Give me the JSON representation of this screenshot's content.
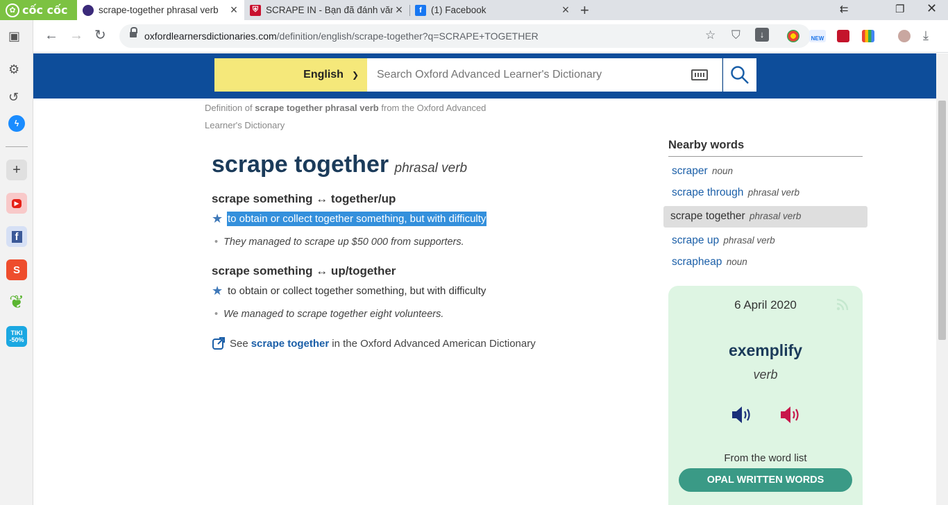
{
  "browser": {
    "brand": "cốc cốc",
    "tabs": [
      {
        "title": "scrape-together phrasal verb",
        "favicon": "oxford-globe-icon",
        "active": true
      },
      {
        "title": "SCRAPE IN - Bạn đã đánh văn",
        "favicon": "cambridge-shield-icon",
        "active": false
      },
      {
        "title": "(1) Facebook",
        "favicon": "facebook-icon",
        "active": false
      }
    ],
    "url_domain": "oxfordlearnersdictionaries.com",
    "url_path": "/definition/english/scrape-together?q=SCRAPE+TOGETHER",
    "sidebar_badges": {
      "shopee": "S",
      "tiki": "TIKI",
      "tiki_discount": "-50%"
    }
  },
  "header": {
    "language": "English",
    "search_placeholder": "Search Oxford Advanced Learner's Dictionary"
  },
  "breadcrumb": {
    "prefix": "Definition of",
    "term": "scrape together phrasal verb",
    "suffix": "from the Oxford Advanced Learner's Dictionary"
  },
  "entry": {
    "headword": "scrape together",
    "pos": "phrasal verb",
    "senses": [
      {
        "pattern": "scrape something ↔ together/up",
        "definition": "to obtain or collect together something, but with difficulty",
        "example": "They managed to scrape up $50 000 from supporters.",
        "highlighted": true
      },
      {
        "pattern": "scrape something ↔ up/together",
        "definition": "to obtain or collect together something, but with difficulty",
        "example": "We managed to scrape together eight volunteers.",
        "highlighted": false
      }
    ],
    "see_also": {
      "prefix": "See",
      "link": "scrape together",
      "suffix": "in the Oxford Advanced American Dictionary"
    }
  },
  "nearby": {
    "title": "Nearby words",
    "items": [
      {
        "word": "scraper",
        "pos": "noun",
        "current": false
      },
      {
        "word": "scrape through",
        "pos": "phrasal verb",
        "current": false
      },
      {
        "word": "scrape together",
        "pos": "phrasal verb",
        "current": true
      },
      {
        "word": "scrape up",
        "pos": "phrasal verb",
        "current": false
      },
      {
        "word": "scrapheap",
        "pos": "noun",
        "current": false
      }
    ]
  },
  "word_of_day": {
    "date": "6 April 2020",
    "word": "exemplify",
    "pos": "verb",
    "from_list_label": "From the word list",
    "list_name": "OPAL WRITTEN WORDS"
  },
  "colors": {
    "header_blue": "#0d4d9a",
    "lang_yellow": "#f5e87a",
    "highlight": "#3490dc",
    "link_blue": "#1b5fa8",
    "wotd_bg": "#def5e3",
    "opal_green": "#3a9a86",
    "uk_speaker": "#1a2f7a",
    "us_speaker": "#c8174b"
  }
}
